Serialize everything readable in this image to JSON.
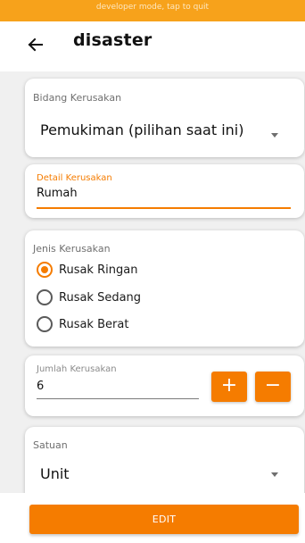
{
  "dev_banner": "developer mode, tap to quit",
  "header": {
    "title": "disaster"
  },
  "bidang": {
    "label": "Bidang Kerusakan",
    "value": "Pemukiman (pilihan saat ini)"
  },
  "detail": {
    "label": "Detail Kerusakan",
    "value": "Rumah"
  },
  "jenis": {
    "label": "Jenis Kerusakan",
    "options": [
      "Rusak Ringan",
      "Rusak Sedang",
      "Rusak Berat"
    ],
    "selected": "Rusak Ringan"
  },
  "jumlah": {
    "label": "Jumlah Kerusakan",
    "value": "6",
    "plus": "+",
    "minus": "−"
  },
  "satuan": {
    "label": "Satuan",
    "value": "Unit"
  },
  "footer": {
    "edit_label": "EDIT"
  },
  "colors": {
    "accent": "#f57c00",
    "dev_banner": "#f7a21b",
    "content_bg": "#f0f0f0"
  }
}
